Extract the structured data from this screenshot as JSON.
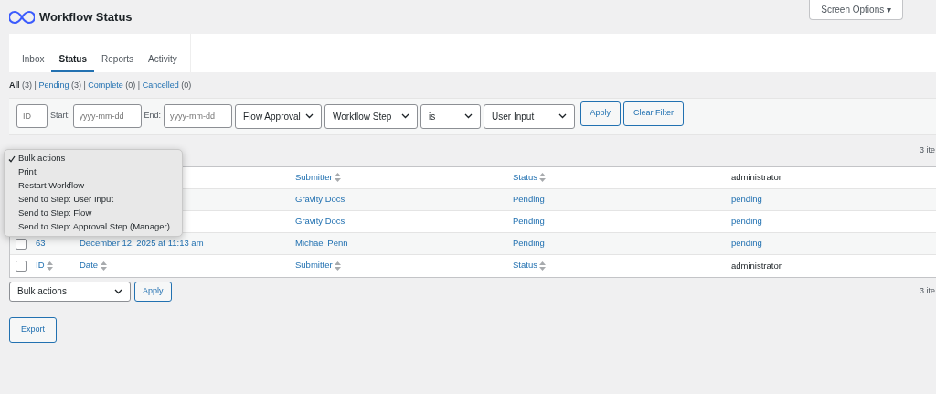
{
  "header": {
    "title": "Workflow Status",
    "screen_options": "Screen Options ▾"
  },
  "tabs": [
    {
      "label": "Inbox",
      "selected": false
    },
    {
      "label": "Status",
      "selected": true
    },
    {
      "label": "Reports",
      "selected": false
    },
    {
      "label": "Activity",
      "selected": false
    }
  ],
  "views": [
    {
      "label": "All",
      "count": "(3)",
      "selected": true
    },
    {
      "separator": "|",
      "label": "Pending",
      "count": "(3)",
      "selected": false
    },
    {
      "separator": "|",
      "label": "Complete",
      "count": "(0)",
      "selected": false
    },
    {
      "separator": "|",
      "label": "Cancelled",
      "count": "(0)",
      "selected": false
    }
  ],
  "filter": {
    "id_placeholder": "ID",
    "start_label": "Start:",
    "start_placeholder": "yyyy-mm-dd",
    "end_label": "End:",
    "end_placeholder": "yyyy-mm-dd",
    "selects": [
      "Flow Approval",
      "Workflow Step",
      "is",
      "User Input"
    ],
    "apply": "Apply",
    "clear": "Clear Filter"
  },
  "top_nav": {
    "count": "3 ite"
  },
  "table": {
    "header": {
      "submitter": "Submitter",
      "status": "Status",
      "column_5": "administrator"
    },
    "rows": [
      {
        "submitter": "Gravity Docs",
        "status": "Pending",
        "step_status": "pending"
      },
      {
        "submitter": "Gravity Docs",
        "status": "Pending",
        "step_status": "pending"
      },
      {
        "id": "63",
        "date": "December 12, 2025 at 11:13 am",
        "submitter": "Michael Penn",
        "status": "Pending",
        "step_status": "pending",
        "checked": false
      }
    ],
    "footer": {
      "id": "ID",
      "date": "Date",
      "submitter": "Submitter",
      "status": "Status",
      "column_5": "administrator",
      "checked": false
    }
  },
  "bulk_menu": [
    {
      "label": "Bulk actions",
      "selected": true
    },
    {
      "label": "Print",
      "selected": false
    },
    {
      "label": "Restart Workflow",
      "selected": false
    },
    {
      "label": "Send to Step: User Input",
      "selected": false
    },
    {
      "label": "Send to Step: Flow",
      "selected": false
    },
    {
      "label": "Send to Step: Approval Step (Manager)",
      "selected": false
    }
  ],
  "bottom_nav": {
    "bulk": "Bulk actions",
    "apply": "Apply",
    "count": "3 ite"
  },
  "export": "Export"
}
